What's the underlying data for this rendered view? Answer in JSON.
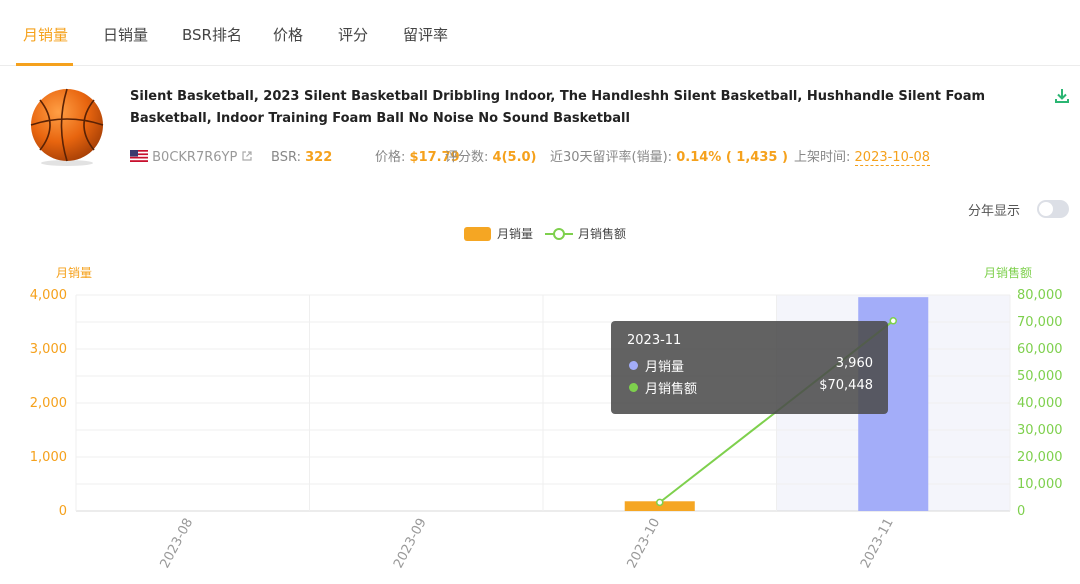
{
  "tabs": [
    "月销量",
    "日销量",
    "BSR排名",
    "价格",
    "评分",
    "留评率"
  ],
  "product": {
    "title": "Silent Basketball, 2023 Silent Basketball Dribbling Indoor, The Handleshh Silent Basketball, Hushhandle Silent Foam Basketball, Indoor Training Foam Ball No Noise No Sound Basketball",
    "asin": "B0CKR7R6YP",
    "bsr_label": "BSR:",
    "bsr_value": "322",
    "price_label": "价格:",
    "price_value": "$17.79",
    "rating_label": "评分数:",
    "rating_value": "4(5.0)",
    "review_rate_label": "近30天留评率(销量):",
    "review_rate_value": "0.14% ( 1,435 )",
    "listed_label": "上架时间:",
    "listed_value": "2023-10-08",
    "image_icon": "basketball-image",
    "flag_icon": "us-flag-icon"
  },
  "toggle": {
    "label": "分年显示",
    "on": false
  },
  "tooltip": {
    "title": "2023-11",
    "rows": [
      {
        "name": "月销量",
        "value": "3,960",
        "color": "#a3adf9"
      },
      {
        "name": "月销售额",
        "value": "$70,448",
        "color": "#7ed04d"
      }
    ]
  },
  "colors": {
    "accent": "#f5a11c",
    "bar": "#f5a623",
    "bar_highlight": "#a3adf9",
    "line": "#7ed04d"
  },
  "chart_data": {
    "type": "bar",
    "categories": [
      "2023-08",
      "2023-09",
      "2023-10",
      "2023-11"
    ],
    "series": [
      {
        "name": "月销量",
        "type": "bar",
        "axis": "left",
        "values": [
          0,
          0,
          180,
          3960
        ]
      },
      {
        "name": "月销售额",
        "type": "line",
        "axis": "right",
        "values": [
          null,
          null,
          3200,
          70448
        ]
      }
    ],
    "ylabel": "月销量",
    "y2label": "月销售额",
    "ylim": [
      0,
      4000
    ],
    "y2lim": [
      0,
      80000
    ],
    "yticks": [
      "0",
      "1,000",
      "2,000",
      "3,000",
      "4,000"
    ],
    "y2ticks": [
      "0",
      "10,000",
      "20,000",
      "30,000",
      "40,000",
      "50,000",
      "60,000",
      "70,000",
      "80,000"
    ],
    "highlighted_category": "2023-11",
    "legend_position": "top-center",
    "grid": true
  }
}
